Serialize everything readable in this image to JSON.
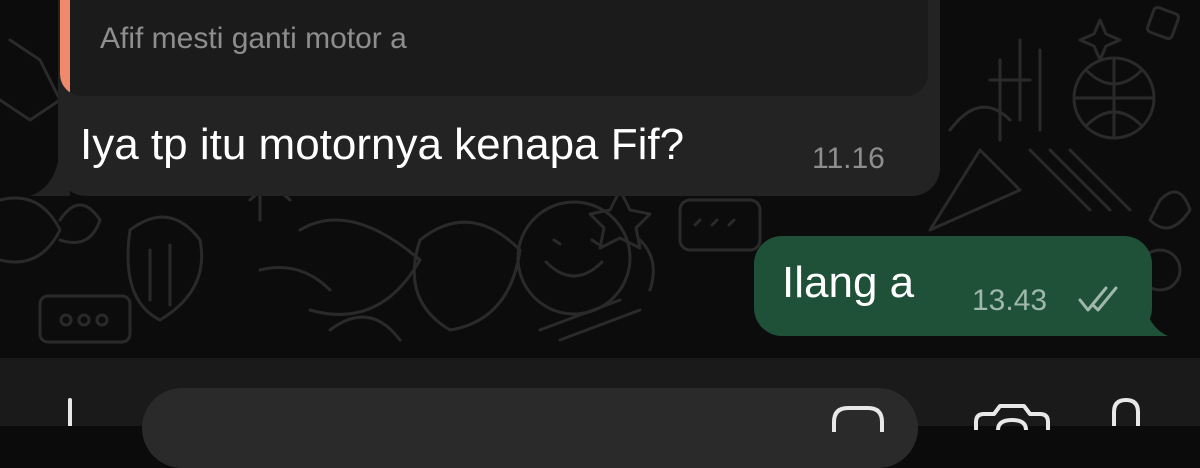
{
  "conversation": {
    "incoming": {
      "quoted_text": "Afif mesti ganti motor a",
      "text": "Iya tp itu motornya kenapa Fif?",
      "time": "11.16"
    },
    "outgoing": {
      "text": "Ilang a",
      "time": "13.43",
      "status_icon": "double-check-icon"
    }
  },
  "input_bar": {
    "icons": [
      "plus-icon",
      "sticker-icon",
      "camera-icon",
      "mic-icon"
    ]
  },
  "colors": {
    "incoming_bubble": "#232323",
    "outgoing_bubble": "#1f5138",
    "quote_accent": "#f08a6a",
    "background": "#0c0c0c"
  }
}
